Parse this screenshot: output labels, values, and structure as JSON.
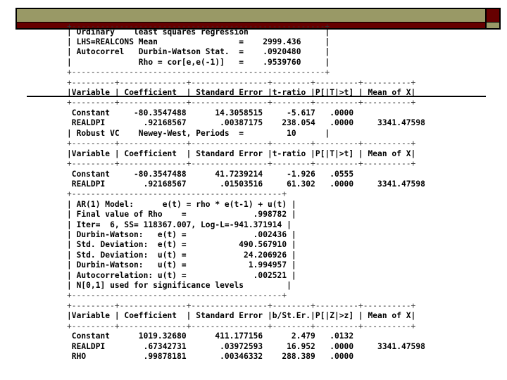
{
  "slide": {
    "colors": {
      "olive": "#999966",
      "maroon": "#660000"
    }
  },
  "summary_box": {
    "border_top": "+-----------------------------------------------------+",
    "lines": [
      "| Ordinary    least squares regression                |",
      "| LHS=REALCONS Mean                 =    2999.436     |",
      "| Autocorrel   Durbin-Watson Stat.  =    .0920480     |",
      "|              Rho = cor[e,e(-1)]   =    .9539760     |"
    ],
    "border_bottom": "+-----------------------------------------------------+"
  },
  "ols_table": {
    "sep": "+---------+--------------+----------------+--------+---------+----------+",
    "header": "|Variable | Coefficient  | Standard Error |t-ratio |P[|T|>t] | Mean of X|",
    "rows": [
      " Constant     -80.3547488      14.3058515     -5.617   .0000",
      " REALDPI        .92168567       .00387175    238.054   .0000     3341.47598"
    ],
    "robust": "| Robust VC    Newey-West, Periods  =         10      |"
  },
  "robust_table": {
    "sep": "+---------+--------------+----------------+--------+---------+----------+",
    "header": "|Variable | Coefficient  | Standard Error |t-ratio |P[|T|>t] | Mean of X|",
    "rows": [
      " Constant     -80.3547488      41.7239214     -1.926   .0555",
      " REALDPI        .92168567       .01503516     61.302   .0000     3341.47598"
    ],
    "bottom": "+--------------------------------------------+"
  },
  "ar1_box": {
    "top": "+--------------------------------------------+",
    "lines": [
      "| AR(1) Model:      e(t) = rho * e(t-1) + u(t) |",
      "| Final value of Rho    =              .998782 |",
      "| Iter=  6, SS= 118367.007, Log-L=-941.371914 |",
      "| Durbin-Watson:   e(t) =              .002436 |",
      "| Std. Deviation:  e(t) =           490.567910 |",
      "| Std. Deviation:  u(t) =            24.206926 |",
      "| Durbin-Watson:   u(t) =             1.994957 |",
      "| Autocorrelation: u(t) =              .002521 |",
      "| N[0,1] used for significance levels         |"
    ],
    "bottom": "+--------------------------------------------+"
  },
  "ar1_table": {
    "sep": "+---------+--------------+----------------+--------+---------+----------+",
    "header": "|Variable | Coefficient  | Standard Error |b/St.Er.|P[|Z|>z] | Mean of X|",
    "rows": [
      " Constant      1019.32680      411.177156      2.479   .0132",
      " REALDPI        .67342731       .03972593     16.952   .0000     3341.47598",
      " RHO            .99878181       .00346332    288.389   .0000"
    ]
  }
}
